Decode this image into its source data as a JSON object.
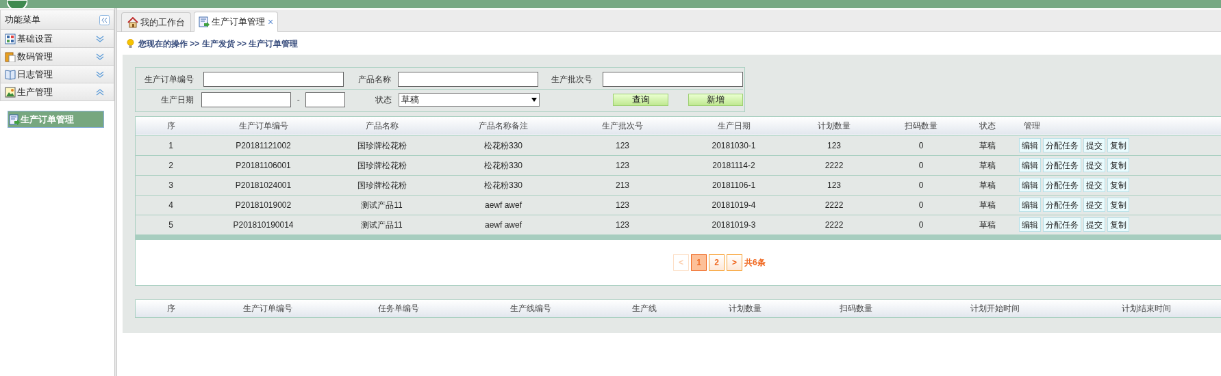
{
  "sidebar": {
    "title": "功能菜单",
    "groups": [
      {
        "label": "基础设置",
        "expanded": false
      },
      {
        "label": "数码管理",
        "expanded": false
      },
      {
        "label": "日志管理",
        "expanded": false
      },
      {
        "label": "生产管理",
        "expanded": true,
        "children": [
          {
            "label": "生产订单管理",
            "selected": true
          }
        ]
      }
    ]
  },
  "tabs": [
    {
      "label": "我的工作台",
      "selected": false
    },
    {
      "label": "生产订单管理",
      "selected": true,
      "close": "×"
    }
  ],
  "breadcrumb": "您现在的操作 >> 生产发货 >> 生产订单管理",
  "filters": {
    "order_no": {
      "label": "生产订单编号"
    },
    "product_name": {
      "label": "产品名称"
    },
    "batch_no": {
      "label": "生产批次号"
    },
    "date": {
      "label": "生产日期",
      "separator": "-"
    },
    "status": {
      "label": "状态",
      "value": "草稿"
    },
    "buttons": [
      "查询",
      "新增"
    ]
  },
  "orders": {
    "columns": [
      "序",
      "生产订单编号",
      "产品名称",
      "产品名称备注",
      "生产批次号",
      "生产日期",
      "计划数量",
      "扫码数量",
      "状态",
      "管理"
    ],
    "rows": [
      {
        "cells": [
          "1",
          "P20181121002",
          "国珍牌松花粉",
          "松花粉330",
          "123",
          "20181030-1",
          "123",
          "0",
          "草稿"
        ],
        "actions": [
          "编辑",
          "分配任务",
          "提交",
          "复制"
        ]
      },
      {
        "cells": [
          "2",
          "P20181106001",
          "国珍牌松花粉",
          "松花粉330",
          "123",
          "20181114-2",
          "2222",
          "0",
          "草稿"
        ],
        "actions": [
          "编辑",
          "分配任务",
          "提交",
          "复制"
        ]
      },
      {
        "cells": [
          "3",
          "P20181024001",
          "国珍牌松花粉",
          "松花粉330",
          "213",
          "20181106-1",
          "123",
          "0",
          "草稿"
        ],
        "actions": [
          "编辑",
          "分配任务",
          "提交",
          "复制"
        ]
      },
      {
        "cells": [
          "4",
          "P20181019002",
          "测试产品11",
          "aewf awef",
          "123",
          "20181019-4",
          "2222",
          "0",
          "草稿"
        ],
        "actions": [
          "编辑",
          "分配任务",
          "提交",
          "复制"
        ]
      },
      {
        "cells": [
          "5",
          "P201810190014",
          "测试产品11",
          "aewf awef",
          "123",
          "20181019-3",
          "2222",
          "0",
          "草稿"
        ],
        "actions": [
          "编辑",
          "分配任务",
          "提交",
          "复制"
        ]
      }
    ]
  },
  "pagination": {
    "prev": {
      "label": "<",
      "disabled": true
    },
    "pages": [
      {
        "label": "1",
        "selected": true
      },
      {
        "label": "2",
        "selected": false
      }
    ],
    "next": {
      "label": ">",
      "disabled": false
    },
    "total": "共6条"
  },
  "tasks": {
    "columns": [
      "序",
      "生产订单编号",
      "任务单编号",
      "生产线编号",
      "生产线",
      "计划数量",
      "扫码数量",
      "计划开始时间",
      "计划结束时间"
    ]
  }
}
